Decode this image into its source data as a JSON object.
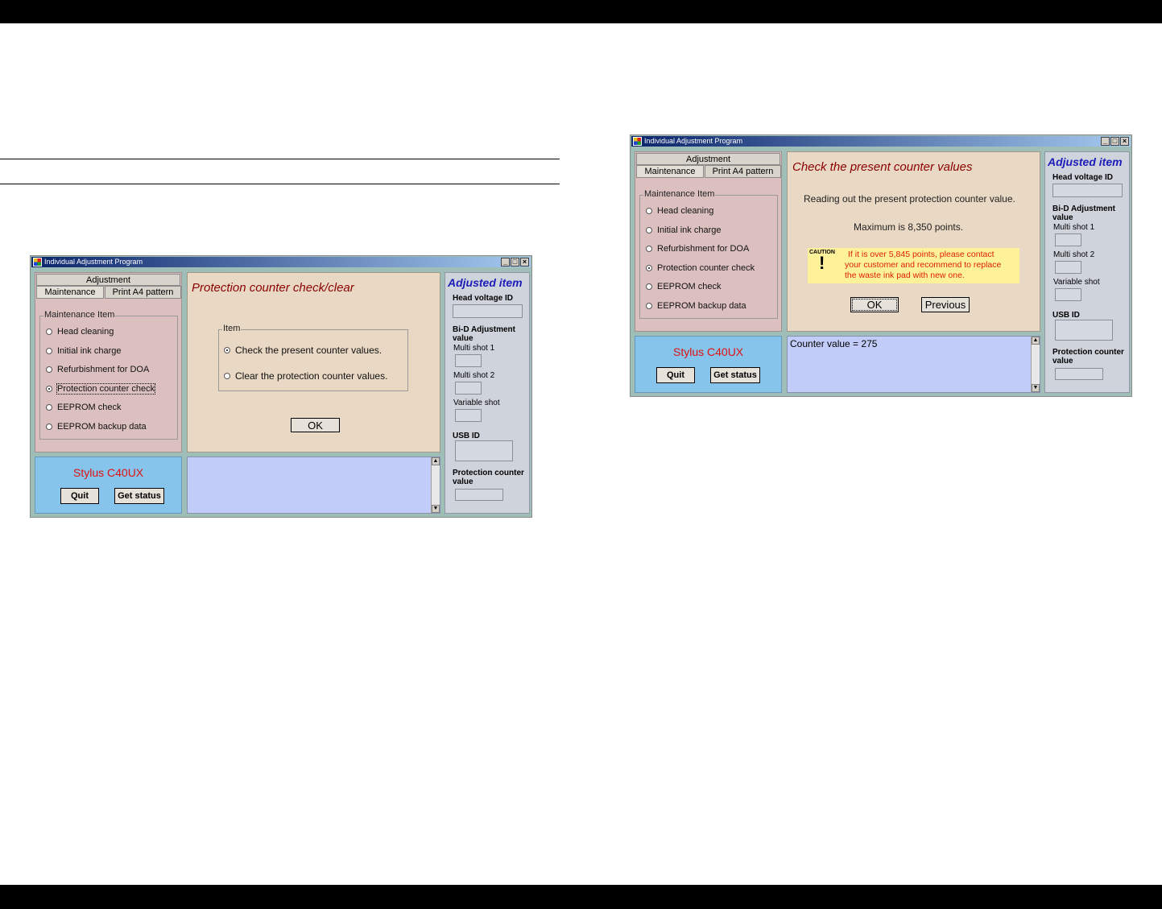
{
  "window1": {
    "title": "Individual Adjustment Program",
    "tabs": {
      "top": "Adjustment",
      "maintenance": "Maintenance",
      "print_a4": "Print A4 pattern"
    },
    "maintenance_group": "Maintenance Item",
    "items": [
      "Head cleaning",
      "Initial ink charge",
      "Refurbishment for DOA",
      "Protection counter check",
      "EEPROM check",
      "EEPROM backup data"
    ],
    "selected_item_index": 3,
    "heading": "Protection counter check/clear",
    "item_group": "Item",
    "options": [
      "Check the present counter values.",
      "Clear the protection counter values."
    ],
    "selected_option_index": 0,
    "ok_label": "OK",
    "model": "Stylus C40UX",
    "quit_label": "Quit",
    "get_status_label": "Get status",
    "adjusted": {
      "title": "Adjusted item",
      "head_voltage_id": "Head voltage ID",
      "bid_adjustment": "Bi-D Adjustment value",
      "multi_shot_1": "Multi shot 1",
      "multi_shot_2": "Multi shot 2",
      "variable_shot": "Variable shot",
      "usb_id": "USB ID",
      "protection_counter": "Protection counter value"
    }
  },
  "window2": {
    "title": "Individual Adjustment Program",
    "tabs": {
      "top": "Adjustment",
      "maintenance": "Maintenance",
      "print_a4": "Print A4 pattern"
    },
    "maintenance_group": "Maintenance Item",
    "items": [
      "Head cleaning",
      "Initial ink charge",
      "Refurbishment for DOA",
      "Protection counter check",
      "EEPROM check",
      "EEPROM backup data"
    ],
    "selected_item_index": 3,
    "heading": "Check the present counter values",
    "reading_text": "Reading out the present protection counter value.",
    "maximum_text": "Maximum is 8,350 points.",
    "caution_word": "CAUTION",
    "caution_line1": "If it is over 5,845 points,  please contact",
    "caution_line2": "your customer and recommend to replace",
    "caution_line3": "the waste ink pad with new one.",
    "ok_label": "OK",
    "previous_label": "Previous",
    "counter_value": "Counter value = 275",
    "model": "Stylus C40UX",
    "quit_label": "Quit",
    "get_status_label": "Get status",
    "adjusted": {
      "title": "Adjusted item",
      "head_voltage_id": "Head voltage ID",
      "bid_adjustment": "Bi-D Adjustment value",
      "multi_shot_1": "Multi shot 1",
      "multi_shot_2": "Multi shot 2",
      "variable_shot": "Variable shot",
      "usb_id": "USB ID",
      "protection_counter": "Protection counter value"
    }
  },
  "colors": {
    "heading": "#8b0000",
    "adjusted_title": "#1c1cb8",
    "model": "#e01010",
    "caution_bg": "#fdf29a",
    "caution_text": "#e02000"
  }
}
